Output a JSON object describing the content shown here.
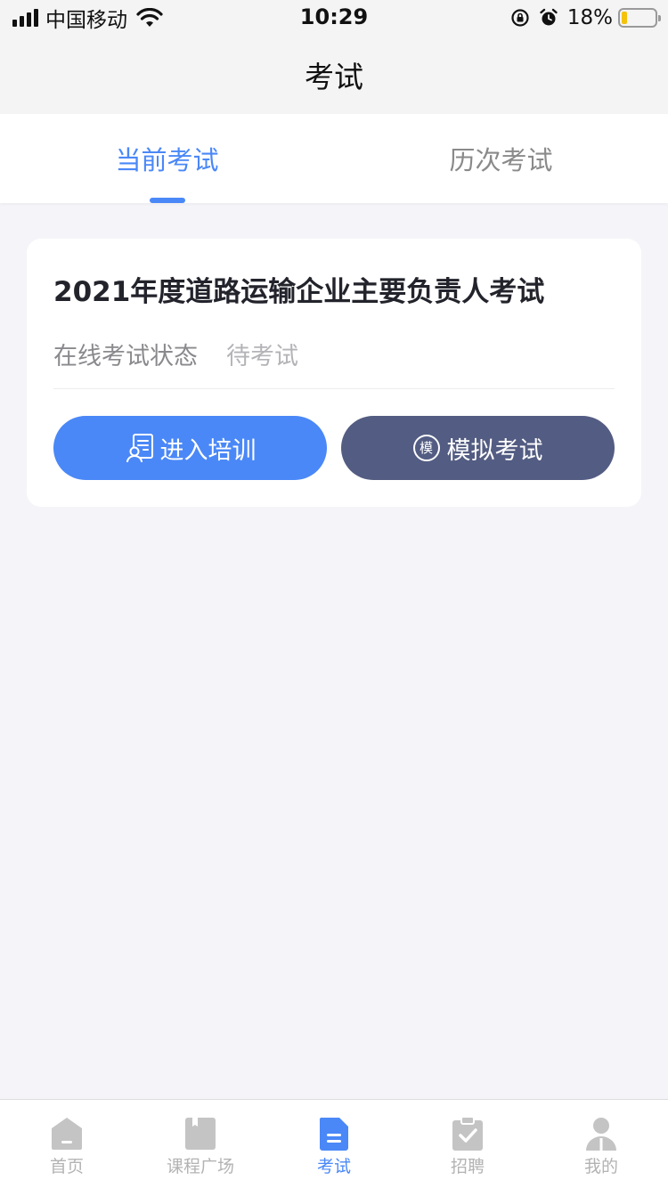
{
  "status_bar": {
    "carrier": "中国移动",
    "time": "10:29",
    "battery_percent": "18%",
    "battery_level": 0.18,
    "icons": [
      "signal-icon",
      "wifi-icon",
      "rotation-lock-icon",
      "alarm-icon",
      "battery-icon"
    ]
  },
  "nav": {
    "title": "考试"
  },
  "tabs": [
    {
      "label": "当前考试",
      "active": true
    },
    {
      "label": "历次考试",
      "active": false
    }
  ],
  "exam_card": {
    "title": "2021年度道路运输企业主要负责人考试",
    "status_label": "在线考试状态",
    "status_value": "待考试",
    "buttons": {
      "train": {
        "label": "进入培训",
        "icon": "training-document-icon"
      },
      "mock": {
        "label": "模拟考试",
        "icon_text": "模"
      }
    }
  },
  "colors": {
    "accent": "#4a88f7",
    "mock_button": "#535c82",
    "inactive": "#b3b3b3",
    "background": "#f5f5f9"
  },
  "tab_bar": [
    {
      "label": "首页",
      "icon": "home-icon",
      "active": false
    },
    {
      "label": "课程广场",
      "icon": "book-icon",
      "active": false
    },
    {
      "label": "考试",
      "icon": "exam-document-icon",
      "active": true
    },
    {
      "label": "招聘",
      "icon": "clipboard-check-icon",
      "active": false
    },
    {
      "label": "我的",
      "icon": "user-icon",
      "active": false
    }
  ]
}
